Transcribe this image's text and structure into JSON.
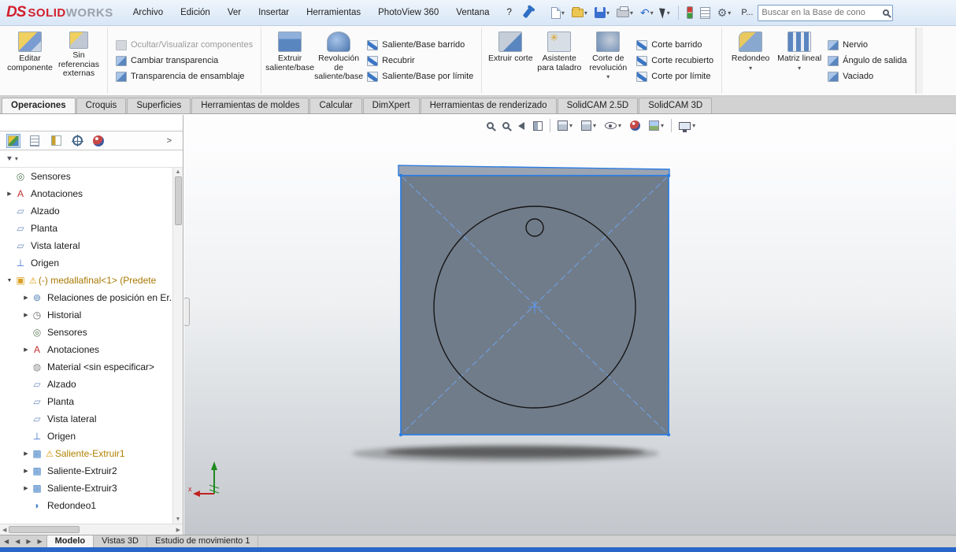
{
  "titlebar": {
    "logo_mark": "DS",
    "logo_solid": "SOLID",
    "logo_works": "WORKS",
    "menus": [
      "Archivo",
      "Edición",
      "Ver",
      "Insertar",
      "Herramientas",
      "PhotoView 360",
      "Ventana",
      "?"
    ],
    "p_label": "P...",
    "search_placeholder": "Buscar en la Base de cono"
  },
  "icons": {
    "caret": "▾",
    "up": "▲",
    "down": "▼",
    "left": "◀",
    "right": "▶",
    "chevron": ">",
    "undo": "↶",
    "gear": "⚙",
    "funnel": "▼"
  },
  "ribbon": {
    "edit_component": "Editar componente",
    "no_external_refs": "Sin referencias externas",
    "visibility": [
      "Ocultar/Visualizar componentes",
      "Cambiar transparencia",
      "Transparencia de ensamblaje"
    ],
    "extrude_boss": "Extruir saliente/base",
    "revolve_boss": "Revolución de saliente/base",
    "boss_more": [
      "Saliente/Base barrido",
      "Recubrir",
      "Saliente/Base por límite"
    ],
    "extrude_cut": "Extruir corte",
    "hole_wizard": "Asistente para taladro",
    "revolve_cut": "Corte de revolución",
    "cut_more": [
      "Corte barrido",
      "Corte recubierto",
      "Corte por límite"
    ],
    "fillet": "Redondeo",
    "linear_pattern": "Matriz lineal",
    "features_more": [
      "Nervio",
      "Ángulo de salida",
      "Vaciado"
    ]
  },
  "tabs": [
    "Operaciones",
    "Croquis",
    "Superficies",
    "Herramientas de moldes",
    "Calcular",
    "DimXpert",
    "Herramientas de renderizado",
    "SolidCAM 2.5D",
    "SolidCAM 3D"
  ],
  "tree": {
    "items": [
      {
        "arrow": "",
        "glyph": "◎",
        "glyph_color": "#5a7a5a",
        "warn": "",
        "label": "Sensores",
        "label_color": "",
        "indent": 0
      },
      {
        "arrow": "▶",
        "glyph": "A",
        "glyph_color": "#c03030",
        "warn": "",
        "label": "Anotaciones",
        "label_color": "",
        "indent": 0
      },
      {
        "arrow": "",
        "glyph": "▱",
        "glyph_color": "#7090c0",
        "warn": "",
        "label": "Alzado",
        "label_color": "",
        "indent": 0
      },
      {
        "arrow": "",
        "glyph": "▱",
        "glyph_color": "#7090c0",
        "warn": "",
        "label": "Planta",
        "label_color": "",
        "indent": 0
      },
      {
        "arrow": "",
        "glyph": "▱",
        "glyph_color": "#7090c0",
        "warn": "",
        "label": "Vista lateral",
        "label_color": "",
        "indent": 0
      },
      {
        "arrow": "",
        "glyph": "⊥",
        "glyph_color": "#3a6fd0",
        "warn": "",
        "label": "Origen",
        "label_color": "",
        "indent": 0
      },
      {
        "arrow": "▼",
        "glyph": "▣",
        "glyph_color": "#d8a020",
        "warn": "⚠",
        "label": "(-) medallafinal<1> (Predete",
        "label_color": "#a87800",
        "indent": 0
      },
      {
        "arrow": "▶",
        "glyph": "⊚",
        "glyph_color": "#4a7ab0",
        "warn": "",
        "label": "Relaciones de posición en Er...",
        "label_color": "",
        "indent": 1
      },
      {
        "arrow": "▶",
        "glyph": "◷",
        "glyph_color": "#666666",
        "warn": "",
        "label": "Historial",
        "label_color": "",
        "indent": 1
      },
      {
        "arrow": "",
        "glyph": "◎",
        "glyph_color": "#5a7a5a",
        "warn": "",
        "label": "Sensores",
        "label_color": "",
        "indent": 1
      },
      {
        "arrow": "▶",
        "glyph": "A",
        "glyph_color": "#c03030",
        "warn": "",
        "label": "Anotaciones",
        "label_color": "",
        "indent": 1
      },
      {
        "arrow": "",
        "glyph": "◍",
        "glyph_color": "#888888",
        "warn": "",
        "label": "Material <sin especificar>",
        "label_color": "",
        "indent": 1
      },
      {
        "arrow": "",
        "glyph": "▱",
        "glyph_color": "#7090c0",
        "warn": "",
        "label": "Alzado",
        "label_color": "",
        "indent": 1
      },
      {
        "arrow": "",
        "glyph": "▱",
        "glyph_color": "#7090c0",
        "warn": "",
        "label": "Planta",
        "label_color": "",
        "indent": 1
      },
      {
        "arrow": "",
        "glyph": "▱",
        "glyph_color": "#7090c0",
        "warn": "",
        "label": "Vista lateral",
        "label_color": "",
        "indent": 1
      },
      {
        "arrow": "",
        "glyph": "⊥",
        "glyph_color": "#3a6fd0",
        "warn": "",
        "label": "Origen",
        "label_color": "",
        "indent": 1
      },
      {
        "arrow": "▶",
        "glyph": "▩",
        "glyph_color": "#4a86c8",
        "warn": "⚠",
        "label": "Saliente-Extruir1",
        "label_color": "#b08000",
        "indent": 1
      },
      {
        "arrow": "▶",
        "glyph": "▩",
        "glyph_color": "#4a86c8",
        "warn": "",
        "label": "Saliente-Extruir2",
        "label_color": "",
        "indent": 1
      },
      {
        "arrow": "▶",
        "glyph": "▩",
        "glyph_color": "#4a86c8",
        "warn": "",
        "label": "Saliente-Extruir3",
        "label_color": "",
        "indent": 1
      },
      {
        "arrow": "",
        "glyph": "◗",
        "glyph_color": "#4a86c8",
        "warn": "",
        "label": "Redondeo1",
        "label_color": "",
        "indent": 1
      }
    ]
  },
  "viewport": {
    "hud_icons": [
      "zoom-fit",
      "zoom-area",
      "previous-view",
      "section-view",
      "view-orientation",
      "display-style",
      "hide-show-items",
      "edit-appearance",
      "apply-scene",
      "view-settings"
    ],
    "model_colors": {
      "face": "#717c8a",
      "top_band": "#9aa4b2",
      "edge_highlight": "#2e7de0",
      "construction": "#6ea3ea",
      "sketch": "#151515"
    },
    "triad": {
      "x_label": "x"
    }
  },
  "bottom_tabs": [
    "Modelo",
    "Vistas 3D",
    "Estudio de movimiento 1"
  ]
}
